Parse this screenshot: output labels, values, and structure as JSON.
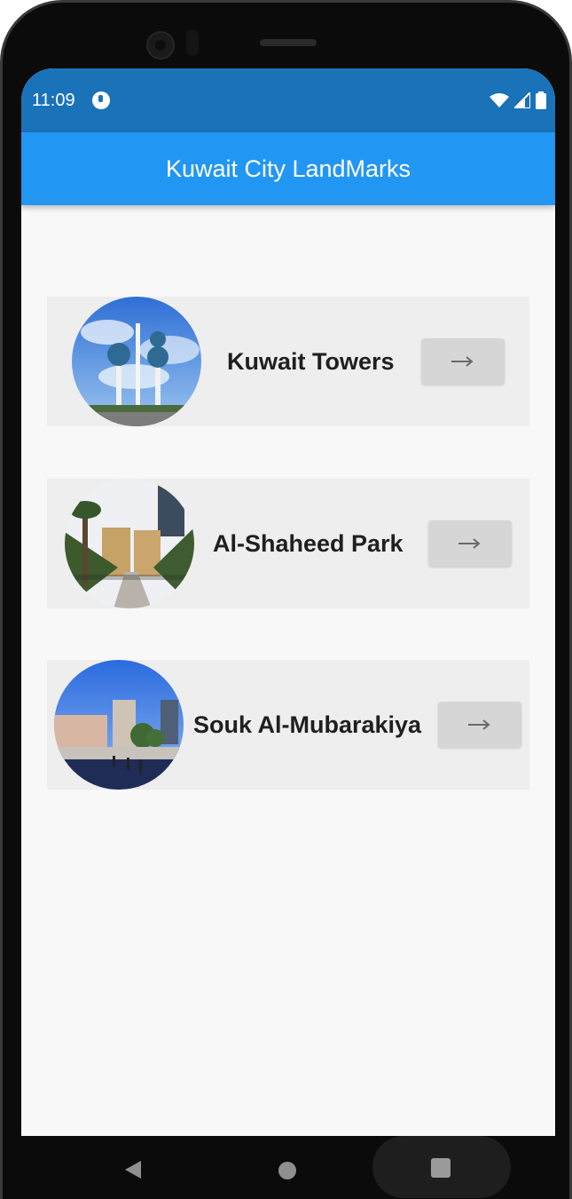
{
  "status_bar": {
    "time": "11:09",
    "background": "#1a72b9"
  },
  "app_bar": {
    "title": "Kuwait City LandMarks",
    "background": "#2296f3"
  },
  "landmarks": [
    {
      "name": "Kuwait Towers",
      "image": "kuwait-towers-photo",
      "button_icon": "arrow-right-icon"
    },
    {
      "name": "Al-Shaheed Park",
      "image": "al-shaheed-park-photo",
      "button_icon": "arrow-right-icon"
    },
    {
      "name": "Souk Al-Mubarakiya",
      "image": "souk-al-mubarakiya-photo",
      "button_icon": "arrow-right-icon"
    }
  ],
  "colors": {
    "card_background": "#eeeeee",
    "button_background": "#d6d6d6",
    "screen_background": "#f8f8f8"
  },
  "nav_bar": {
    "icons": [
      "back-icon",
      "home-icon",
      "recents-icon"
    ]
  }
}
